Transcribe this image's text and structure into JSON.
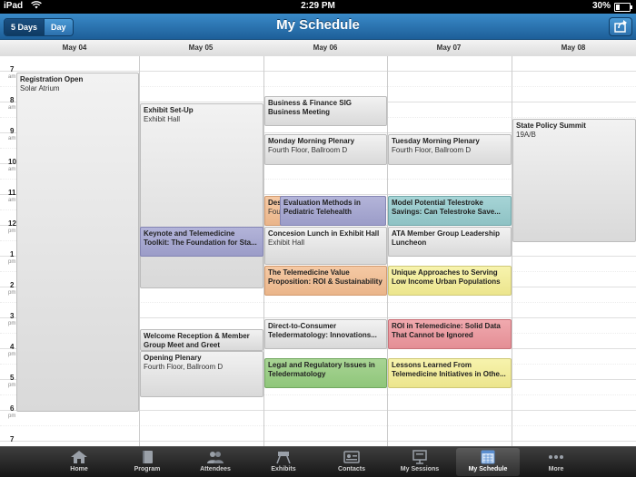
{
  "status": {
    "carrier": "iPad",
    "time": "2:29 PM",
    "battery": "30%",
    "battery_level": 0.3
  },
  "nav": {
    "title": "My Schedule",
    "view_5days": "5 Days",
    "view_day": "Day"
  },
  "days": [
    "May 04",
    "May 05",
    "May 06",
    "May 07",
    "May 08"
  ],
  "hours": [
    {
      "num": "7",
      "ampm": "am"
    },
    {
      "num": "8",
      "ampm": "am"
    },
    {
      "num": "9",
      "ampm": "am"
    },
    {
      "num": "10",
      "ampm": "am"
    },
    {
      "num": "11",
      "ampm": "am"
    },
    {
      "num": "12",
      "ampm": "pm"
    },
    {
      "num": "1",
      "ampm": "pm"
    },
    {
      "num": "2",
      "ampm": "pm"
    },
    {
      "num": "3",
      "ampm": "pm"
    },
    {
      "num": "4",
      "ampm": "pm"
    },
    {
      "num": "5",
      "ampm": "pm"
    },
    {
      "num": "6",
      "ampm": "pm"
    },
    {
      "num": "7",
      "ampm": ""
    }
  ],
  "events": {
    "registration": {
      "title": "Registration Open",
      "location": "Solar Atrium"
    },
    "exhibit_setup": {
      "title": "Exhibit Set-Up",
      "location": "Exhibit Hall"
    },
    "keynote": {
      "title": "Keynote and Telemedicine Toolkit:  The Foundation for Sta..."
    },
    "welcome": {
      "title": "Welcome Reception & Member Group Meet and Greet"
    },
    "opening_plenary": {
      "title": "Opening Plenary",
      "location": "Fourth Floor, Ballroom D"
    },
    "business_finance": {
      "title": "Business & Finance SIG Business Meeting"
    },
    "monday_plenary": {
      "title": "Monday Morning Plenary",
      "location": "Fourth Floor, Ballroom D"
    },
    "des_partial": {
      "title": "Des",
      "location": "Four"
    },
    "evaluation": {
      "title": "Evaluation Methods in Pediatric Telehealth"
    },
    "concession": {
      "title": "Concesion Lunch in Exhibit Hall",
      "location": "Exhibit Hall"
    },
    "value_prop": {
      "title": "The Telemedicine Value Proposition:  ROI & Sustainability"
    },
    "d2c": {
      "title": "Direct-to-Consumer Teledermatology: Innovations..."
    },
    "legal": {
      "title": "Legal and Regulatory Issues in Teledermatology"
    },
    "tuesday_plenary": {
      "title": "Tuesday Morning Plenary",
      "location": "Fourth Floor, Ballroom D"
    },
    "stroke": {
      "title": "Model Potential Telestroke Savings: Can Telestroke Save..."
    },
    "ata_lunch": {
      "title": "ATA Member Group Leadership Luncheon"
    },
    "unique": {
      "title": "Unique Approaches to Serving Low Income Urban Populations"
    },
    "roi": {
      "title": "ROI in Telemedicine: Solid Data That Cannot be Ignored"
    },
    "lessons": {
      "title": "Lessons Learned From Telemedicine Initiatives in Othe..."
    },
    "state_policy": {
      "title": "State Policy Summit",
      "location": "19A/B"
    }
  },
  "tabs": [
    {
      "label": "Home",
      "icon": "home-icon"
    },
    {
      "label": "Program",
      "icon": "book-icon"
    },
    {
      "label": "Attendees",
      "icon": "people-icon"
    },
    {
      "label": "Exhibits",
      "icon": "flags-icon"
    },
    {
      "label": "Contacts",
      "icon": "contact-card-icon"
    },
    {
      "label": "My Sessions",
      "icon": "presentation-icon"
    },
    {
      "label": "My Schedule",
      "icon": "calendar-icon"
    },
    {
      "label": "More",
      "icon": "ellipsis-icon"
    }
  ],
  "selected_tab": "My Schedule"
}
